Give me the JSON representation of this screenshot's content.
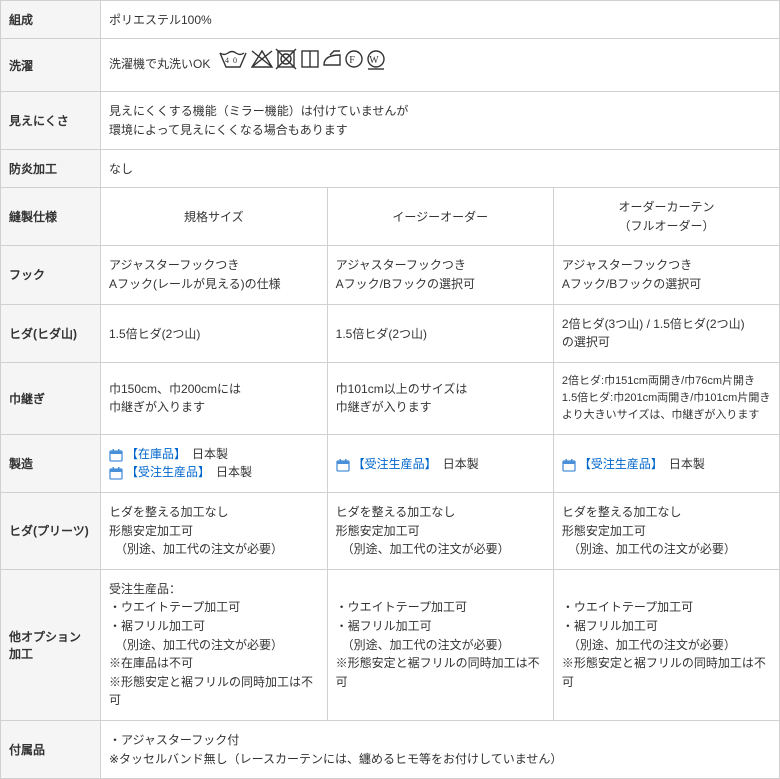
{
  "rows": {
    "composition": {
      "label": "組成",
      "value": "ポリエステル100%"
    },
    "wash": {
      "label": "洗濯",
      "value": "洗濯機で丸洗いOK"
    },
    "visibility": {
      "label": "見えにくさ",
      "line1": "見えにくくする機能（ミラー機能）は付けていませんが",
      "line2": "環境によって見えにくくなる場合もあります"
    },
    "flame": {
      "label": "防炎加工",
      "value": "なし"
    },
    "spec": {
      "label": "縫製仕様"
    },
    "hook": {
      "label": "フック"
    },
    "pleat_mt": {
      "label": "ヒダ(ヒダ山)"
    },
    "seam": {
      "label": "巾継ぎ"
    },
    "mfg": {
      "label": "製造"
    },
    "pleat": {
      "label": "ヒダ(プリーツ)"
    },
    "option": {
      "label": "他オプション加工"
    },
    "acc": {
      "label": "付属品",
      "line1": "・アジャスターフック付",
      "line2": "※タッセルバンド無し（レースカーテンには、纏めるヒモ等をお付けしていません）"
    }
  },
  "cols": {
    "c1": {
      "head": "規格サイズ"
    },
    "c2": {
      "head": "イージーオーダー"
    },
    "c3": {
      "head_l1": "オーダーカーテン",
      "head_l2": "（フルオーダー）"
    }
  },
  "hook": {
    "c1_l1": "アジャスターフックつき",
    "c1_l2": "Aフック(レールが見える)の仕様",
    "c2_l1": "アジャスターフックつき",
    "c2_l2": "Aフック/Bフックの選択可",
    "c3_l1": "アジャスターフックつき",
    "c3_l2": "Aフック/Bフックの選択可"
  },
  "pleat_mt": {
    "c1": "1.5倍ヒダ(2つ山)",
    "c2": "1.5倍ヒダ(2つ山)",
    "c3_l1": "2倍ヒダ(3つ山) / 1.5倍ヒダ(2つ山)",
    "c3_l2": "の選択可"
  },
  "seam": {
    "c1_l1": "巾150cm、巾200cmには",
    "c1_l2": "巾継ぎが入ります",
    "c2_l1": "巾101cm以上のサイズは",
    "c2_l2": "巾継ぎが入ります",
    "c3_l1": "2倍ヒダ:巾151cm両開き/巾76cm片開き",
    "c3_l2": "1.5倍ヒダ:巾201cm両開き/巾101cm片開き",
    "c3_l3": "より大きいサイズは、巾継ぎが入ります"
  },
  "mfg": {
    "stock": "【在庫品】",
    "order": "【受注生産品】",
    "jp": "日本製"
  },
  "pleat": {
    "l1": "ヒダを整える加工なし",
    "l2": "形態安定加工可",
    "l3": "　（別途、加工代の注文が必要）"
  },
  "option": {
    "c1_l1": "受注生産品：",
    "c1_l2": "・ウエイトテープ加工可",
    "c1_l3": "・裾フリル加工可",
    "c1_l4": "　（別途、加工代の注文が必要）",
    "c1_l5": "※在庫品は不可",
    "c1_l6": "※形態安定と裾フリルの同時加工は不可",
    "c2_l1": "・ウエイトテープ加工可",
    "c2_l2": "・裾フリル加工可",
    "c2_l3": "　（別途、加工代の注文が必要）",
    "c2_l4": "※形態安定と裾フリルの同時加工は不可",
    "c3_l1": "・ウエイトテープ加工可",
    "c3_l2": "・裾フリル加工可",
    "c3_l3": "　（別途、加工代の注文が必要）",
    "c3_l4": "※形態安定と裾フリルの同時加工は不可"
  },
  "icons": {
    "wash_set": "care-symbols",
    "calendar": "calendar-icon"
  }
}
